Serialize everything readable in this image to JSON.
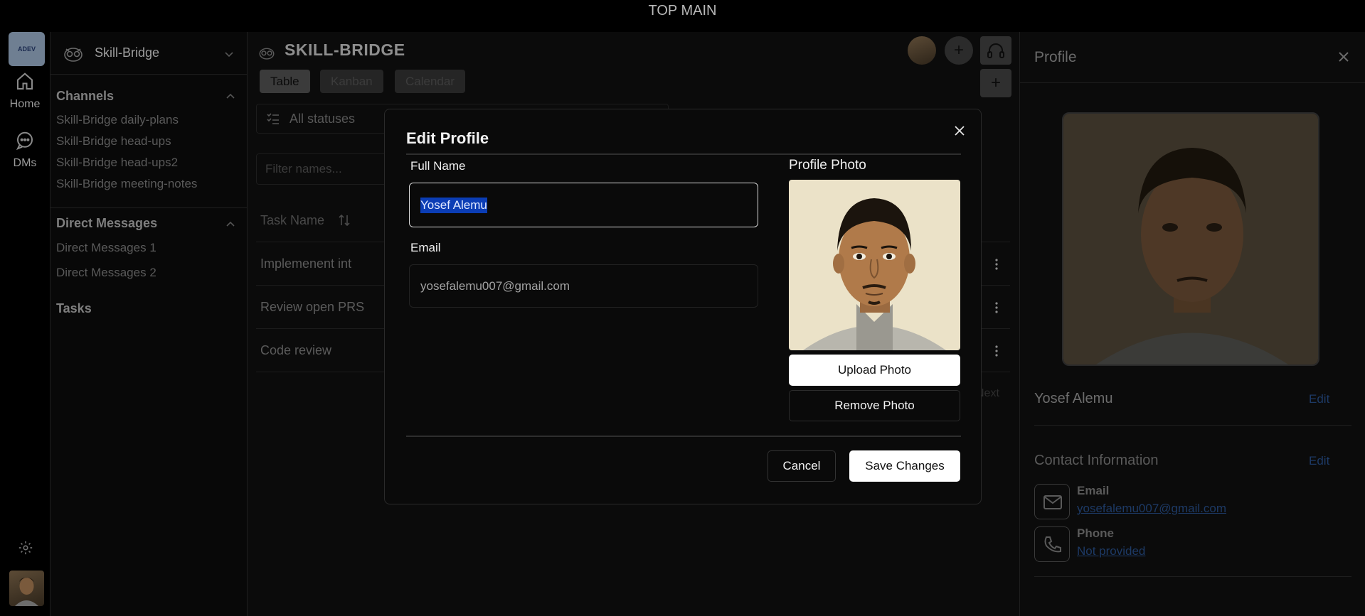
{
  "topbar": {
    "title": "TOP MAIN"
  },
  "rail": {
    "logo_text": "ADEV",
    "home_label": "Home",
    "dms_label": "DMs"
  },
  "sidebar": {
    "workspace_name": "Skill-Bridge",
    "channels_title": "Channels",
    "channels": [
      "Skill-Bridge daily-plans",
      "Skill-Bridge head-ups",
      "Skill-Bridge head-ups2",
      "Skill-Bridge meeting-notes"
    ],
    "dm_title": "Direct Messages",
    "dms": [
      "Direct Messages 1",
      "Direct Messages 2"
    ],
    "tasks_title": "Tasks"
  },
  "main": {
    "title": "SKILL-BRIDGE",
    "tabs": [
      "Table",
      "Kanban",
      "Calendar"
    ],
    "add_label": "+",
    "status_filter": "All statuses",
    "filter_placeholder": "Filter names...",
    "table_header": "Task Name",
    "rows": [
      "Implemenent int",
      "Review open PRS",
      "Code review"
    ],
    "next_label": "Next"
  },
  "panel": {
    "title": "Profile",
    "name": "Yosef Alemu",
    "edit_label": "Edit",
    "contact_title": "Contact Information",
    "email_label": "Email",
    "email_value": "yosefalemu007@gmail.com",
    "phone_label": "Phone",
    "phone_value": "Not provided"
  },
  "modal": {
    "title": "Edit Profile",
    "full_name_label": "Full Name",
    "full_name_value": "Yosef Alemu",
    "email_label": "Email",
    "email_value": "yosefalemu007@gmail.com",
    "photo_label": "Profile Photo",
    "upload_label": "Upload Photo",
    "remove_label": "Remove Photo",
    "cancel_label": "Cancel",
    "save_label": "Save Changes"
  },
  "colors": {
    "accent_link": "#1d3a66",
    "selection": "#0b3db5"
  }
}
